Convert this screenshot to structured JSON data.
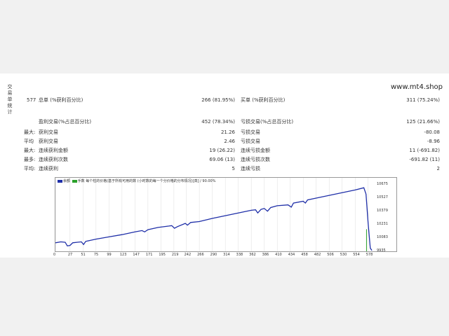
{
  "side_label": "交易单统计",
  "brand": "www.mt4.shop",
  "stats": [
    {
      "left_prefix": "577",
      "left_label": "总单 (%获利百分比)",
      "left_value": "266 (81.95%)",
      "right_label": "买单 (%获利百分比)",
      "right_value": "311 (75.24%)"
    },
    {
      "left_prefix": "",
      "left_label": "盈利交易(%占总百分比)",
      "left_value": "452 (78.34%)",
      "right_label": "亏损交易(%占总百分比)",
      "right_value": "125 (21.66%)"
    },
    {
      "left_prefix": "最大:",
      "left_label": "获利交易",
      "left_value": "21.26",
      "right_label": "亏损交易",
      "right_value": "-80.08"
    },
    {
      "left_prefix": "平均",
      "left_label": "获利交易",
      "left_value": "2.46",
      "right_label": "亏损交易",
      "right_value": "-8.96"
    },
    {
      "left_prefix": "最大:",
      "left_label": "连续获利金额",
      "left_value": "19 (26.22)",
      "right_label": "连续亏损金额",
      "right_value": "11 (-691.82)"
    },
    {
      "left_prefix": "最多:",
      "left_label": "连续获利次数",
      "left_value": "69.06 (13)",
      "right_label": "连续亏损次数",
      "right_value": "-691.82 (11)"
    },
    {
      "left_prefix": "平均:",
      "left_label": "连续获利",
      "left_value": "5",
      "right_label": "连续亏损",
      "right_value": "2"
    }
  ],
  "chart_legend": {
    "item1": "余额",
    "item2": "手数",
    "text": "每个柱的价格(基于所有可用的数 (小时数的每一个分价格的分布情况)[真] / 90.00%"
  },
  "colors": {
    "line": "#1f2fa8",
    "drop": "#2aa02a",
    "grid": "#dddddd"
  },
  "chart_data": {
    "type": "line",
    "x_ticks": [
      "0",
      "27",
      "51",
      "75",
      "99",
      "123",
      "147",
      "171",
      "195",
      "219",
      "242",
      "266",
      "290",
      "314",
      "338",
      "362",
      "386",
      "410",
      "434",
      "458",
      "482",
      "506",
      "530",
      "554",
      "578"
    ],
    "y_ticks": [
      "10675",
      "10527",
      "10379",
      "10231",
      "10083",
      "9935"
    ],
    "xlim": [
      0,
      590
    ],
    "ylim": [
      9935,
      10750
    ],
    "series": [
      {
        "values": [
          [
            0,
            10030
          ],
          [
            10,
            10040
          ],
          [
            18,
            10035
          ],
          [
            22,
            9995
          ],
          [
            27,
            10000
          ],
          [
            32,
            10030
          ],
          [
            40,
            10035
          ],
          [
            48,
            10040
          ],
          [
            52,
            10010
          ],
          [
            56,
            10045
          ],
          [
            75,
            10070
          ],
          [
            99,
            10095
          ],
          [
            123,
            10120
          ],
          [
            147,
            10150
          ],
          [
            160,
            10165
          ],
          [
            165,
            10150
          ],
          [
            171,
            10175
          ],
          [
            190,
            10200
          ],
          [
            210,
            10215
          ],
          [
            215,
            10220
          ],
          [
            220,
            10190
          ],
          [
            226,
            10210
          ],
          [
            240,
            10245
          ],
          [
            244,
            10225
          ],
          [
            250,
            10255
          ],
          [
            266,
            10265
          ],
          [
            290,
            10300
          ],
          [
            314,
            10330
          ],
          [
            338,
            10360
          ],
          [
            362,
            10390
          ],
          [
            370,
            10395
          ],
          [
            374,
            10360
          ],
          [
            380,
            10400
          ],
          [
            386,
            10410
          ],
          [
            392,
            10380
          ],
          [
            398,
            10420
          ],
          [
            410,
            10440
          ],
          [
            430,
            10450
          ],
          [
            436,
            10425
          ],
          [
            440,
            10470
          ],
          [
            458,
            10490
          ],
          [
            462,
            10470
          ],
          [
            466,
            10505
          ],
          [
            482,
            10525
          ],
          [
            506,
            10555
          ],
          [
            530,
            10585
          ],
          [
            554,
            10615
          ],
          [
            570,
            10640
          ],
          [
            574,
            10570
          ],
          [
            578,
            10250
          ],
          [
            582,
            9970
          ],
          [
            585,
            9945
          ]
        ]
      }
    ]
  }
}
